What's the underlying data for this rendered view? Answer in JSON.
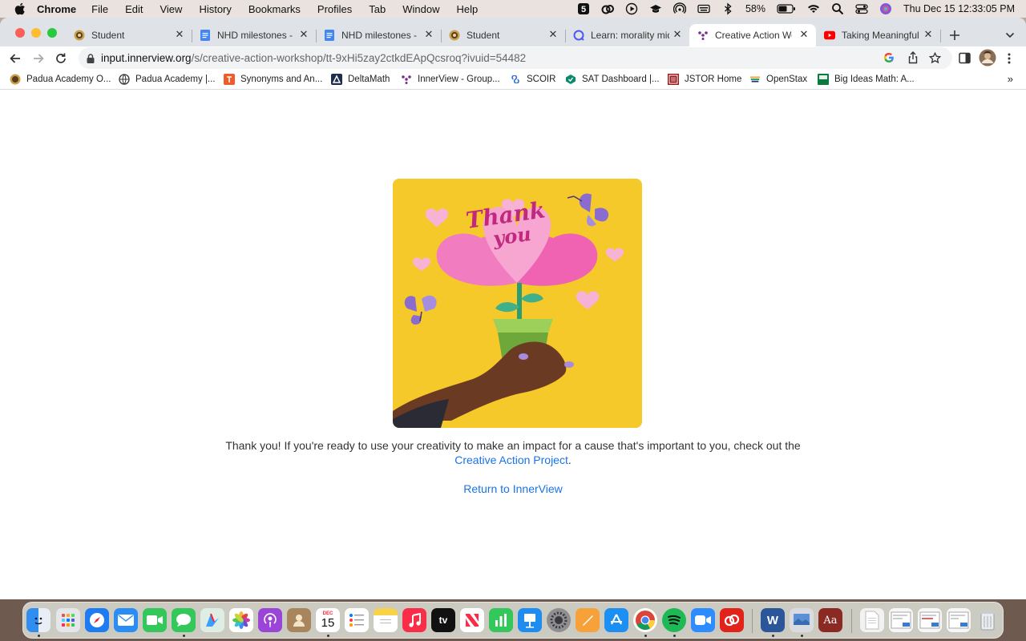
{
  "menubar": {
    "app_name": "Chrome",
    "items": [
      "File",
      "Edit",
      "View",
      "History",
      "Bookmarks",
      "Profiles",
      "Tab",
      "Window",
      "Help"
    ],
    "battery": "58%",
    "datetime": "Thu Dec 15  12:33:05 PM"
  },
  "tabs": [
    {
      "title": "Student",
      "icon": "crest-icon"
    },
    {
      "title": "NHD milestones - G",
      "icon": "docs-icon"
    },
    {
      "title": "NHD milestones - G",
      "icon": "docs-icon"
    },
    {
      "title": "Student",
      "icon": "crest-icon"
    },
    {
      "title": "Learn: morality mid",
      "icon": "search-bubble-icon"
    },
    {
      "title": "Creative Action Wor",
      "icon": "innerview-icon"
    },
    {
      "title": "Taking Meaningful,",
      "icon": "youtube-icon"
    }
  ],
  "address": {
    "domain": "input.innerview.org",
    "path": "/s/creative-action-workshop/tt-9xHi5zay2ctkdEApQcsroq?ivuid=54482"
  },
  "bookmarks": [
    {
      "label": "Padua Academy O...",
      "icon": "crest-icon"
    },
    {
      "label": "Padua Academy |...",
      "icon": "globe-icon"
    },
    {
      "label": "Synonyms and An...",
      "icon": "thesaurus-icon"
    },
    {
      "label": "DeltaMath",
      "icon": "deltamath-icon"
    },
    {
      "label": "InnerView - Group...",
      "icon": "innerview-icon"
    },
    {
      "label": "SCOIR",
      "icon": "scoir-icon"
    },
    {
      "label": "SAT Dashboard |...",
      "icon": "sat-icon"
    },
    {
      "label": "JSTOR Home",
      "icon": "jstor-icon"
    },
    {
      "label": "OpenStax",
      "icon": "openstax-icon"
    },
    {
      "label": "Big Ideas Math: A...",
      "icon": "bigideas-icon"
    }
  ],
  "bookmarks_overflow": "»",
  "card": {
    "handwritten_text_line1": "Thank",
    "handwritten_text_line2": "you",
    "bg_color": "#f6c92a"
  },
  "message": {
    "text_before": "Thank you! If you're ready to use your creativity to make an impact for a cause that's important to you, check out the ",
    "link": "Creative Action Project",
    "text_after": "."
  },
  "return_link": "Return to InnerView",
  "dock": {
    "calendar_month": "DEC",
    "calendar_day": "15",
    "dictionary_label": "Aa",
    "appletv_label": "tv"
  }
}
